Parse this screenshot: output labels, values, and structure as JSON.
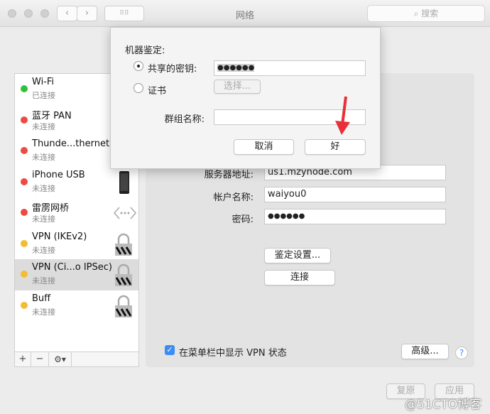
{
  "window": {
    "title": "网络",
    "search_placeholder": "搜索"
  },
  "colors": {
    "connected": "#2ec23c",
    "disconnected": "#ec4a44",
    "inactive": "#f5bc32",
    "accent": "#3b8cf5",
    "arrow": "#e8303a"
  },
  "sidebar": {
    "items": [
      {
        "name": "Wi-Fi",
        "status": "已连接",
        "state": "connected",
        "icon": "none"
      },
      {
        "name": "蓝牙 PAN",
        "status": "未连接",
        "state": "disconnected",
        "icon": "none"
      },
      {
        "name": "Thunde...thernet",
        "status": "未连接",
        "state": "disconnected",
        "icon": "none"
      },
      {
        "name": "iPhone USB",
        "status": "未连接",
        "state": "disconnected",
        "icon": "iphone-icon"
      },
      {
        "name": "雷雳网桥",
        "status": "未连接",
        "state": "disconnected",
        "icon": "bridge-icon"
      },
      {
        "name": "VPN (IKEv2)",
        "status": "未连接",
        "state": "inactive",
        "icon": "lock-icon"
      },
      {
        "name": "VPN (Ci...o IPSec)",
        "status": "未连接",
        "state": "inactive",
        "icon": "lock-icon",
        "selected": true
      },
      {
        "name": "Buff",
        "status": "未连接",
        "state": "inactive",
        "icon": "lock-icon"
      }
    ],
    "add": "+",
    "remove": "−",
    "gear": "⚙▾"
  },
  "form": {
    "server_label": "服务器地址:",
    "server": "us1.mzynode.com",
    "account_label": "帐户名称:",
    "account": "waiyou0",
    "password_label": "密码:",
    "password": "●●●●●●",
    "auth_button": "鉴定设置...",
    "connect_button": "连接",
    "show_vpn_label": "在菜单栏中显示 VPN 状态",
    "show_vpn_checked": true,
    "advanced_button": "高级...",
    "help": "?"
  },
  "footer": {
    "revert": "复原",
    "apply": "应用"
  },
  "dialog": {
    "heading": "机器鉴定:",
    "shared_secret_label": "共享的密钥:",
    "shared_secret": "●●●●●●",
    "certificate_label": "证书",
    "select_button": "选择...",
    "group_label": "群组名称:",
    "group_value": "",
    "cancel": "取消",
    "ok": "好",
    "selected_option": "shared_secret"
  },
  "watermark": "@51CTO博客"
}
